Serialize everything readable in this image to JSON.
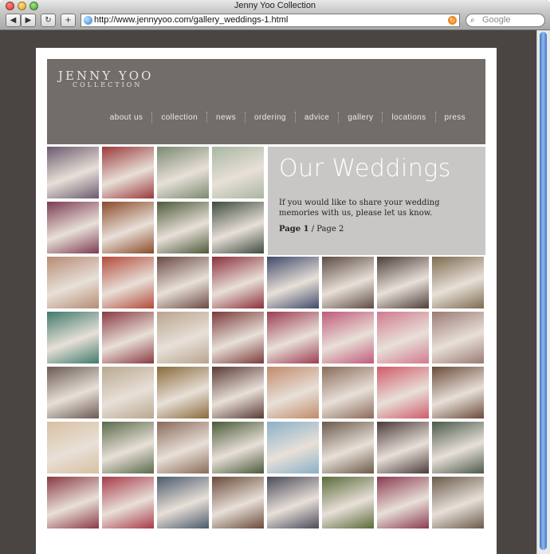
{
  "browser": {
    "window_title": "Jenny Yoo Collection",
    "url": "http://www.jennyyoo.com/gallery_weddings-1.html",
    "search_placeholder": "Google",
    "buttons": {
      "back": "◀",
      "forward": "▶",
      "reload": "↻",
      "add": "+"
    }
  },
  "site": {
    "logo_line1": "JENNY YOO",
    "logo_line2": "COLLECTION",
    "nav": [
      "about us",
      "collection",
      "news",
      "ordering",
      "advice",
      "gallery",
      "locations",
      "press"
    ]
  },
  "weddings": {
    "title": "Our Weddings",
    "text": "If you would like to share your wedding memories with us, please let us know.",
    "page_current": "Page 1",
    "page_sep": "/",
    "page_other": "Page 2"
  },
  "photo_colors": [
    "#6b5a6e",
    "#9a3a3a",
    "#7a8a70",
    "#a8b7a0",
    "#7c3b52",
    "#8a4a2a",
    "#4d5a3a",
    "#3e4b3e",
    "#b58b74",
    "#b24a3a",
    "#6a4a42",
    "#8b2f3a",
    "#3f4a6a",
    "#5c4b44",
    "#4d3f3a",
    "#7c6b4f",
    "#3f7a6a",
    "#8a3a42",
    "#b8a48e",
    "#7a3a3a",
    "#9c3c52",
    "#c05a7a",
    "#d07a8e",
    "#9a7a72",
    "#6a5a52",
    "#b8a890",
    "#8a6a3a",
    "#5a3a34",
    "#c08a6a",
    "#8a6a5a",
    "#d05a6a",
    "#6a4a3a",
    "#d8c0a0",
    "#5a6a4a",
    "#8a6a5a",
    "#4a5a3a",
    "#8ab0c8",
    "#6a5a4a",
    "#4a3a3a",
    "#4a5a4a",
    "#8a3a42",
    "#a83a4a",
    "#4a5a6a",
    "#6a4a3a",
    "#4a4a5a",
    "#5a6a3a",
    "#8a3a52",
    "#6a5a4a"
  ]
}
